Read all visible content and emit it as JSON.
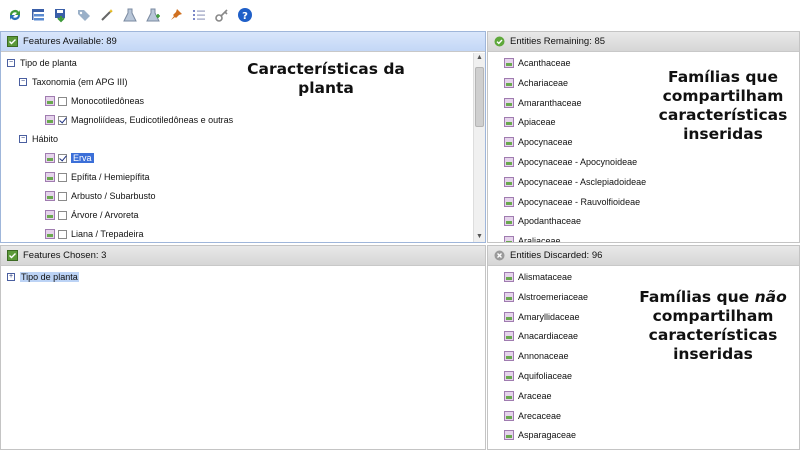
{
  "toolbar": {
    "buttons": [
      {
        "icon": "refresh-icon"
      },
      {
        "icon": "tree-icon"
      },
      {
        "icon": "save-icon"
      },
      {
        "icon": "tag-icon"
      },
      {
        "icon": "magic-wand-icon"
      },
      {
        "icon": "flask-icon"
      },
      {
        "icon": "flask-add-icon"
      },
      {
        "icon": "pin-icon"
      },
      {
        "icon": "list-icon"
      },
      {
        "icon": "key-icon"
      },
      {
        "icon": "help-icon"
      }
    ]
  },
  "available": {
    "title": "Features Available: 89",
    "tree": [
      {
        "label": "Tipo de planta",
        "level": 0,
        "type": "group"
      },
      {
        "label": "Taxonomia (em APG III)",
        "level": 1,
        "type": "group"
      },
      {
        "label": "Monocotiledôneas",
        "level": 2,
        "type": "leaf",
        "checked": false
      },
      {
        "label": "Magnoliídeas, Eudicotiledôneas e outras",
        "level": 2,
        "type": "leaf",
        "checked": true
      },
      {
        "label": "Hábito",
        "level": 1,
        "type": "group"
      },
      {
        "label": "Erva",
        "level": 2,
        "type": "leaf",
        "checked": true,
        "highlight": true
      },
      {
        "label": "Epífita / Hemiepífita",
        "level": 2,
        "type": "leaf",
        "checked": false
      },
      {
        "label": "Arbusto / Subarbusto",
        "level": 2,
        "type": "leaf",
        "checked": false
      },
      {
        "label": "Árvore / Arvoreta",
        "level": 2,
        "type": "leaf",
        "checked": false
      },
      {
        "label": "Liana / Trepadeira",
        "level": 2,
        "type": "leaf",
        "checked": false
      }
    ]
  },
  "remaining": {
    "title": "Entities Remaining: 85",
    "items": [
      "Acanthaceae",
      "Achariaceae",
      "Amaranthaceae",
      "Apiaceae",
      "Apocynaceae",
      "Apocynaceae - Apocynoideae",
      "Apocynaceae - Asclepiadoideae",
      "Apocynaceae - Rauvolfioideae",
      "Apodanthaceae",
      "Araliaceae"
    ]
  },
  "chosen": {
    "title": "Features Chosen: 3",
    "tree": [
      {
        "label": "Tipo de planta"
      }
    ]
  },
  "discarded": {
    "title": "Entities Discarded: 96",
    "items": [
      "Alismataceae",
      "Alstroemeriaceae",
      "Amaryllidaceae",
      "Anacardiaceae",
      "Annonaceae",
      "Aquifoliaceae",
      "Araceae",
      "Arecaceae",
      "Asparagaceae"
    ]
  },
  "annotations": {
    "features_line1": "Características da",
    "features_line2": "planta",
    "remaining_line1": "Famílias que",
    "remaining_line2": "compartilham",
    "remaining_line3": "características",
    "remaining_line4": "inseridas",
    "discarded_line1a": "Famílias que ",
    "discarded_line1b": "não",
    "discarded_line2": "compartilham",
    "discarded_line3": "características",
    "discarded_line4": "inseridas"
  },
  "colors": {
    "header_blue": "#c3d7f6",
    "header_gray": "#d6d6d6",
    "highlight": "#3b6fd8"
  }
}
